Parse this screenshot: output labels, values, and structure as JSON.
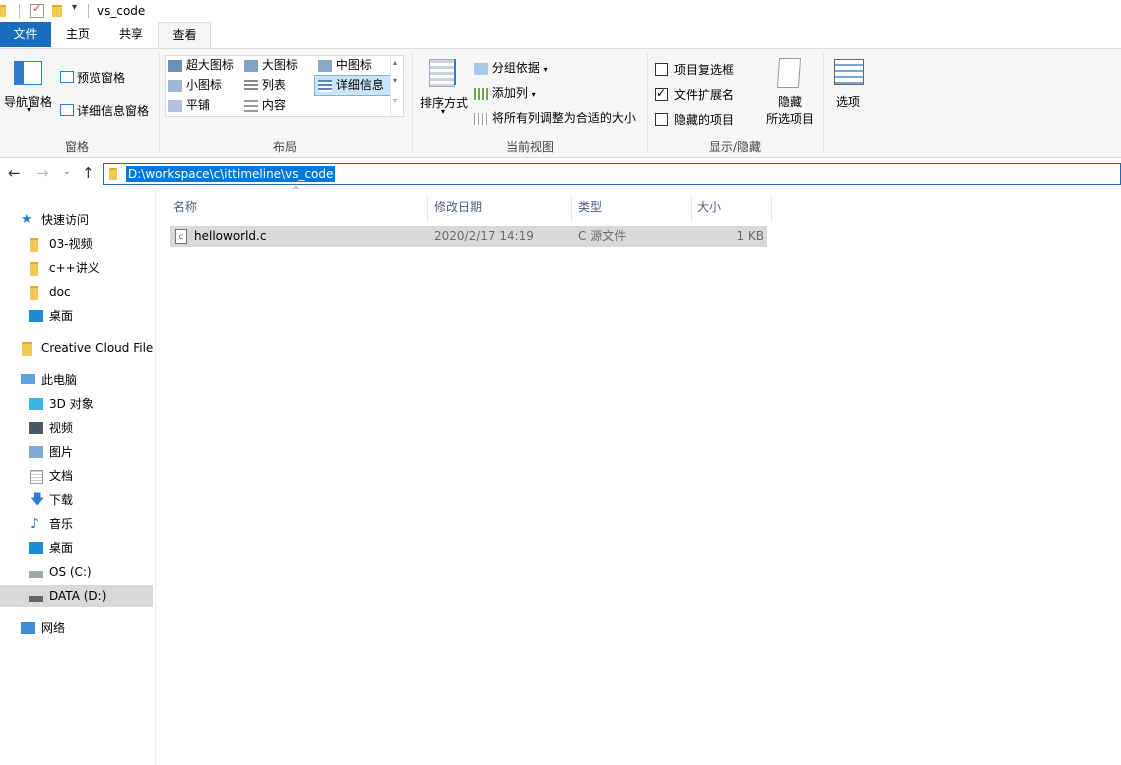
{
  "window": {
    "title": "vs_code"
  },
  "tabs": {
    "file": "文件",
    "home": "主页",
    "share": "共享",
    "view": "查看"
  },
  "ribbon": {
    "panes": {
      "nav_pane": "导航窗格",
      "preview_pane": "预览窗格",
      "details_pane": "详细信息窗格",
      "group_label": "窗格"
    },
    "layout": {
      "extra_large_icons": "超大图标",
      "large_icons": "大图标",
      "medium_icons": "中图标",
      "small_icons": "小图标",
      "list": "列表",
      "details": "详细信息",
      "tiles": "平铺",
      "content": "内容",
      "group_label": "布局"
    },
    "current_view": {
      "sort_by": "排序方式",
      "group_by": "分组依据",
      "add_columns": "添加列",
      "size_all_columns": "将所有列调整为合适的大小",
      "group_label": "当前视图"
    },
    "show_hide": {
      "item_checkboxes": "项目复选框",
      "item_checkboxes_checked": false,
      "file_extensions": "文件扩展名",
      "file_extensions_checked": true,
      "hidden_items": "隐藏的项目",
      "hidden_items_checked": false,
      "hide_selected_line1": "隐藏",
      "hide_selected_line2": "所选项目",
      "group_label": "显示/隐藏"
    },
    "options": "选项"
  },
  "address": {
    "path": "D:\\workspace\\c\\ittimeline\\vs_code"
  },
  "nav": {
    "quick_access": "快速访问",
    "items_quick": [
      "03-视频",
      "c++讲义",
      "doc",
      "桌面"
    ],
    "creative_cloud": "Creative Cloud Files",
    "this_pc": "此电脑",
    "items_pc": [
      "3D 对象",
      "视频",
      "图片",
      "文档",
      "下载",
      "音乐",
      "桌面",
      "OS (C:)",
      "DATA (D:)"
    ],
    "network": "网络"
  },
  "columns": {
    "name": "名称",
    "date_modified": "修改日期",
    "type": "类型",
    "size": "大小"
  },
  "files": [
    {
      "name": "helloworld.c",
      "date": "2020/2/17 14:19",
      "type": "C 源文件",
      "size": "1 KB"
    }
  ],
  "colors": {
    "accent": "#1a6dbc",
    "selection": "#d9d9d9",
    "ribbon_bg": "#f5f6f7"
  }
}
